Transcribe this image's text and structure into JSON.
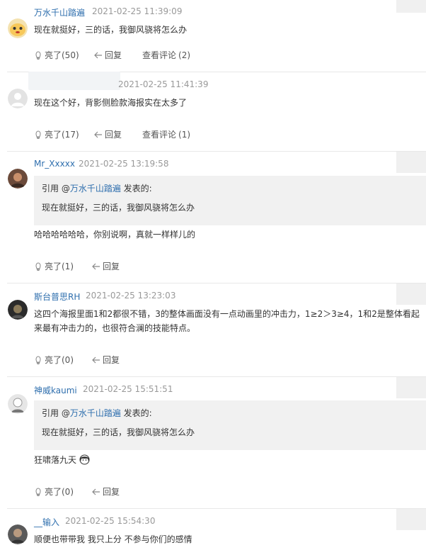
{
  "actions": {
    "reply_label": "回复",
    "view_comments_label": "查看评论"
  },
  "quote_prefix": "引用 @",
  "quote_suffix": " 发表的:",
  "comments": [
    {
      "name": "万水千山踏遍",
      "time": "2021-02-25 11:39:09",
      "text": "现在就挺好，三的话，我御风骁将怎么办",
      "likes": "亮了(50)",
      "comment_count": "(2)"
    },
    {
      "name": "",
      "time": "2021-02-25 11:41:39",
      "text": "现在这个好，背影侧脸款海报实在太多了",
      "likes": "亮了(17)",
      "comment_count": "(1)"
    },
    {
      "name": "Mr_Xxxxx",
      "time": "2021-02-25 13:19:58",
      "quote_name": "万水千山踏遍",
      "quote_text": "现在就挺好，三的话，我御风骁将怎么办",
      "text": "哈哈哈哈哈哈，你别说啊，真就一样样儿的",
      "likes": "亮了(1)"
    },
    {
      "name": "斯台普思RH",
      "time": "2021-02-25 13:23:03",
      "text_line1": "这四个海报里面1和2都很不错，3的整体画面没有一点动画里的冲击力，1≥2＞3≥4，1和2是整体看起",
      "text_line2": "来最有冲击力的，也很符合澜的技能特点。",
      "likes": "亮了(0)"
    },
    {
      "name": "神威kaumi",
      "time": "2021-02-25 15:51:51",
      "quote_name": "万水千山踏遍",
      "quote_text": "现在就挺好，三的话，我御风骁将怎么办",
      "text": "狂啸落九天",
      "likes": "亮了(0)"
    },
    {
      "name": "__输入",
      "time": "2021-02-25 15:54:30",
      "text": "顺便也带带我 我只上分 不参与你们的感情"
    }
  ]
}
